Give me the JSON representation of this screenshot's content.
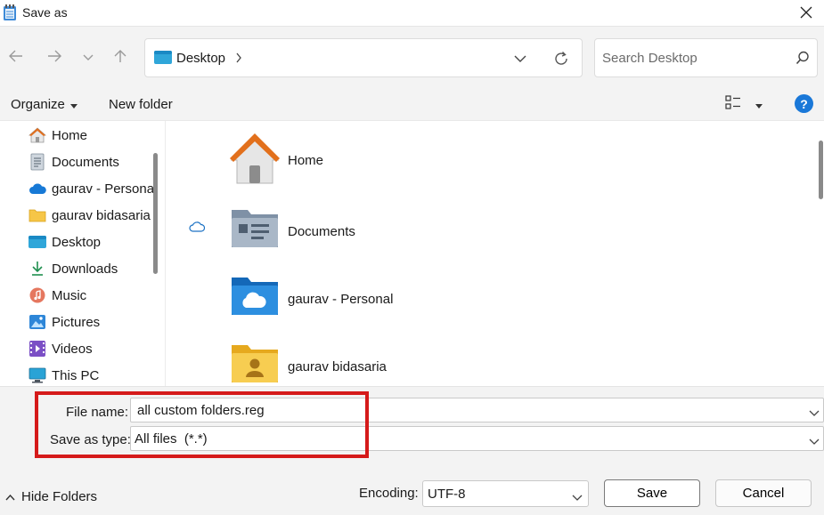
{
  "window": {
    "title": "Save as"
  },
  "nav": {
    "location": "Desktop",
    "separator": "›"
  },
  "search": {
    "placeholder": "Search Desktop"
  },
  "toolbar": {
    "organize": "Organize",
    "new_folder": "New folder",
    "help": "?"
  },
  "sidebar": {
    "items": [
      {
        "label": "Home",
        "icon": "home-icon"
      },
      {
        "label": "Documents",
        "icon": "documents-icon"
      },
      {
        "label": "gaurav - Personal",
        "icon": "onedrive-icon"
      },
      {
        "label": "gaurav bidasaria",
        "icon": "user-folder-icon"
      },
      {
        "label": "Desktop",
        "icon": "desktop-icon"
      },
      {
        "label": "Downloads",
        "icon": "download-icon"
      },
      {
        "label": "Music",
        "icon": "music-icon"
      },
      {
        "label": "Pictures",
        "icon": "pictures-icon"
      },
      {
        "label": "Videos",
        "icon": "videos-icon"
      },
      {
        "label": "This PC",
        "icon": "computer-icon"
      }
    ]
  },
  "content": {
    "items": [
      {
        "label": "Home",
        "icon": "home-icon"
      },
      {
        "label": "Documents",
        "icon": "documents-folder-icon"
      },
      {
        "label": "gaurav - Personal",
        "icon": "onedrive-folder-icon"
      },
      {
        "label": "gaurav bidasaria",
        "icon": "user-folder-icon"
      }
    ]
  },
  "form": {
    "file_name_label": "File name:",
    "file_name_value": "all custom folders.reg",
    "save_type_label": "Save as type:",
    "save_type_value": "All files  (*.*)"
  },
  "footer": {
    "hide_folders": "Hide Folders",
    "encoding_label": "Encoding:",
    "encoding_value": "UTF-8",
    "save": "Save",
    "cancel": "Cancel"
  },
  "colors": {
    "highlight": "#d51a1a",
    "accent": "#1a78d8"
  }
}
